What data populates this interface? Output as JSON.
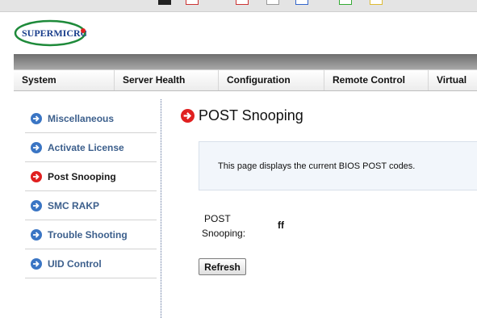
{
  "brand": {
    "logo_text": "SUPERMICRO"
  },
  "nav": {
    "items": [
      "System",
      "Server Health",
      "Configuration",
      "Remote Control",
      "Virtual"
    ]
  },
  "sidebar": {
    "items": [
      {
        "label": "Miscellaneous",
        "active": false
      },
      {
        "label": "Activate License",
        "active": false
      },
      {
        "label": "Post Snooping",
        "active": true
      },
      {
        "label": "SMC RAKP",
        "active": false
      },
      {
        "label": "Trouble Shooting",
        "active": false
      },
      {
        "label": "UID Control",
        "active": false
      }
    ]
  },
  "main": {
    "title": "POST Snooping",
    "info_text": "This page displays the current BIOS POST codes.",
    "post_label_line1": "POST",
    "post_label_line2": "Snooping:",
    "post_value": "ff",
    "refresh_label": "Refresh"
  },
  "colors": {
    "accent_blue": "#3a75c4",
    "active_red": "#e02020",
    "sidebar_text": "#3c5f8c"
  },
  "icons": {
    "inactive": "arrow-right-circle-blue-icon",
    "active": "arrow-right-circle-red-icon"
  }
}
